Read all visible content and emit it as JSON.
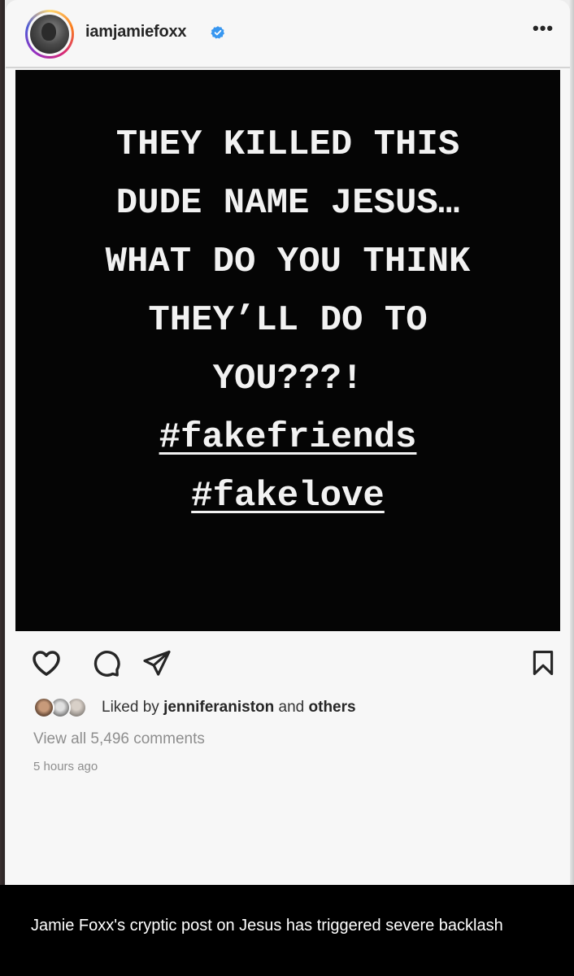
{
  "post": {
    "username": "iamjamiefoxx",
    "verified": true,
    "more_label": "•••",
    "image_lines": [
      "THEY KILLED THIS",
      "DUDE NAME JESUS…",
      "WHAT DO YOU THINK",
      "THEY’LL DO TO",
      "YOU???!"
    ],
    "hashtags": [
      "#fakefriends",
      "#fakelove"
    ],
    "likes": {
      "prefix": "Liked by",
      "user": "jenniferaniston",
      "connector": "and",
      "others": "others"
    },
    "comments_label": "View all 5,496 comments",
    "time_label": "5 hours ago"
  },
  "icons": {
    "like": "heart-icon",
    "comment": "comment-icon",
    "share": "share-icon",
    "save": "bookmark-icon",
    "verified": "verified-badge-icon"
  },
  "colors": {
    "verified_blue": "#3897f0",
    "post_background": "#050505",
    "post_text": "#f2f2f2"
  },
  "caption": "Jamie Foxx's cryptic post on Jesus has triggered severe backlash"
}
